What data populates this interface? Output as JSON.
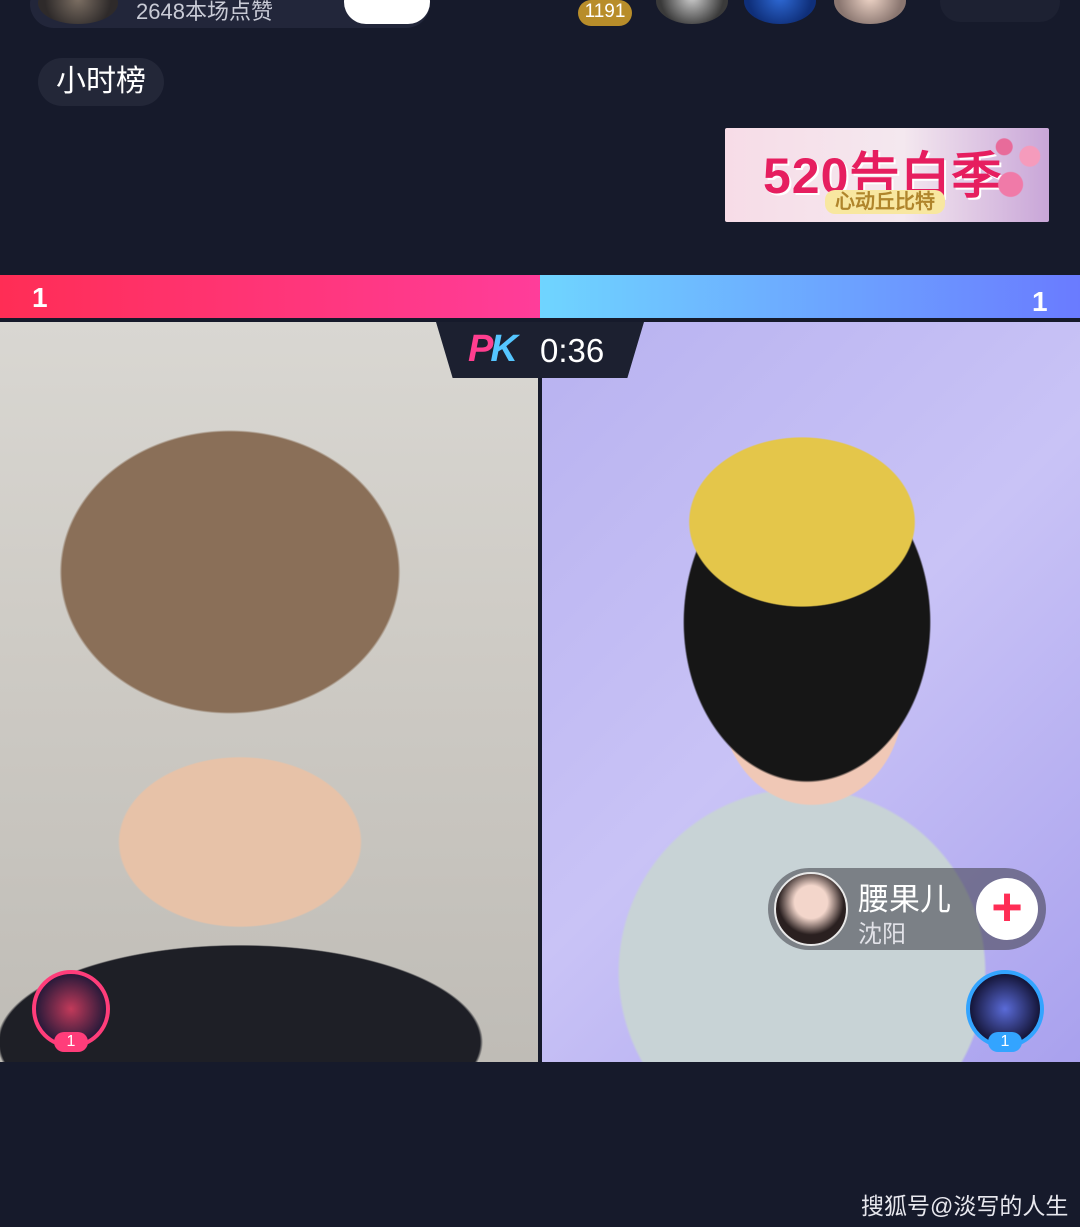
{
  "top_bar": {
    "host_likes": "2648本场点赞",
    "coin_count": "1191"
  },
  "hour_rank_label": "小时榜",
  "event_banner": {
    "title": "520告白季",
    "subtitle": "心动丘比特"
  },
  "pk": {
    "left_score": "1",
    "right_score": "1",
    "logo": "PK",
    "timer": "0:36",
    "colors": {
      "left": "#ff2d55",
      "right": "#6a7bff"
    }
  },
  "contributors": {
    "left_rank": "1",
    "right_rank": "1"
  },
  "opponent": {
    "name": "腰果儿",
    "city": "沈阳",
    "follow_symbol": "+"
  },
  "watermark": "搜狐号@淡写的人生"
}
